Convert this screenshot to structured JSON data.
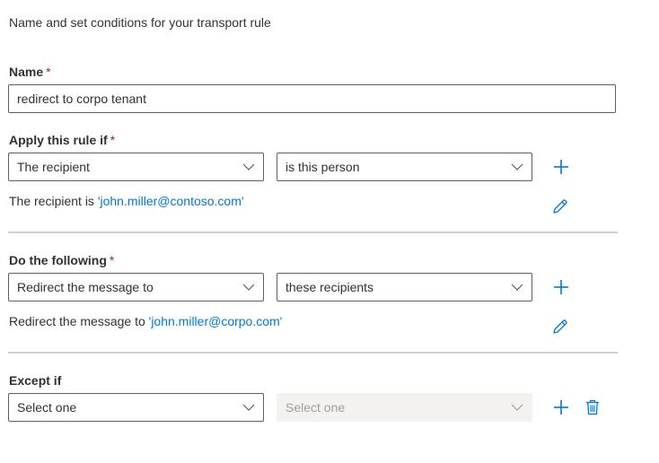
{
  "intro": "Name and set conditions for your transport rule",
  "name_section": {
    "label": "Name",
    "required_mark": "*",
    "value": "redirect to corpo tenant"
  },
  "apply_section": {
    "label": "Apply this rule if",
    "required_mark": "*",
    "condition": "The recipient",
    "operator": "is this person",
    "summary_prefix": "The recipient is ",
    "summary_value": "'john.miller@contoso.com'"
  },
  "do_section": {
    "label": "Do the following",
    "required_mark": "*",
    "action": "Redirect the message to",
    "target": "these recipients",
    "summary_prefix": "Redirect the message to ",
    "summary_value": "'john.miller@corpo.com'"
  },
  "except_section": {
    "label": "Except if",
    "condition": "Select one",
    "operator": "Select one"
  },
  "icons": {
    "add": "plus-icon",
    "edit": "pencil-icon",
    "delete": "trash-icon",
    "dropdown": "chevron-down-icon"
  },
  "colors": {
    "accent": "#0078d4",
    "required": "#a4262c",
    "text": "#323130",
    "border": "#605e5c",
    "disabled_bg": "#f3f2f1",
    "divider": "#d2d0ce"
  }
}
